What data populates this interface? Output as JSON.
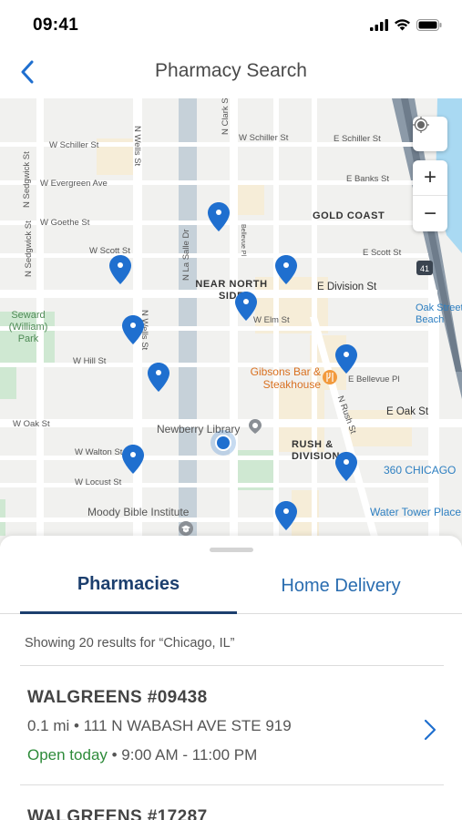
{
  "status_bar": {
    "time": "09:41"
  },
  "nav": {
    "title": "Pharmacy Search"
  },
  "map": {
    "streets": [
      "W Schiller St",
      "W Evergreen Ave",
      "W Goethe St",
      "W Scott St",
      "W Hill St",
      "W Oak St",
      "W Walton St",
      "W Locust St",
      "W Elm St",
      "E Division St",
      "E Schiller St",
      "E Banks St",
      "E Scott St",
      "E Bellevue Pl",
      "E Oak St",
      "N Sedgwick St",
      "N Wells St",
      "N La Salle Dr",
      "N Clark St",
      "N Rush St",
      "W Schiller St",
      "Bellevue Pl"
    ],
    "areas": [
      "GOLD COAST",
      "NEAR NORTH SIDE",
      "RUSH & DIVISION"
    ],
    "pois": {
      "park": "Seward (William) Park",
      "restaurant": "Gibsons Bar & Steakhouse",
      "library": "Newberry Library",
      "institute": "Moody Bible Institute",
      "chicago360": "360 CHICAGO",
      "water_tower": "Water Tower Place",
      "oak_street_beach": "Oak Street Beach",
      "highway": "41"
    },
    "zoom_in": "+",
    "zoom_out": "−"
  },
  "tabs": {
    "pharmacies": "Pharmacies",
    "home_delivery": "Home Delivery"
  },
  "results_text": "Showing 20 results for “Chicago, IL”",
  "pharmacies": [
    {
      "name": "WALGREENS #09438",
      "address": "0.1 mi • 111 N WABASH AVE STE 919",
      "status": "Open today",
      "hours": " • 9:00 AM - 11:00 PM"
    },
    {
      "name": "WALGREENS #17287"
    }
  ],
  "colors": {
    "primary": "#1c3f6e",
    "link": "#2a6db0",
    "open": "#2e8b3a",
    "pin": "#1f6fcf"
  }
}
